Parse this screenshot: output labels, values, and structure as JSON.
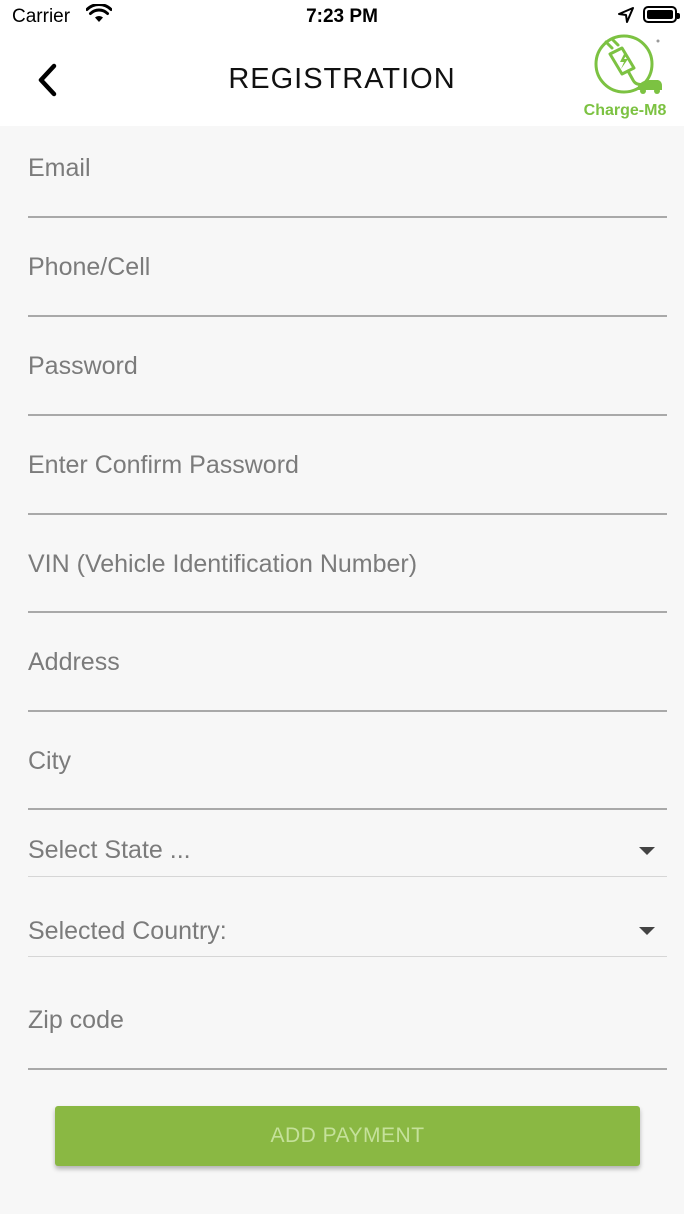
{
  "status_bar": {
    "carrier": "Carrier",
    "time": "7:23 PM"
  },
  "header": {
    "title": "REGISTRATION",
    "logo_text": "Charge-M8"
  },
  "form": {
    "fields": [
      {
        "placeholder": "Email"
      },
      {
        "placeholder": "Phone/Cell"
      },
      {
        "placeholder": "Password"
      },
      {
        "placeholder": "Enter Confirm Password"
      },
      {
        "placeholder": "VIN (Vehicle Identification Number)"
      },
      {
        "placeholder": "Address"
      },
      {
        "placeholder": "City"
      }
    ],
    "state_select": {
      "placeholder": "Select State ..."
    },
    "country_select": {
      "placeholder": "Selected Country:"
    },
    "zip": {
      "placeholder": "Zip code"
    }
  },
  "add_payment_button": {
    "label": "ADD PAYMENT"
  },
  "colors": {
    "accent": "#8ab843",
    "brand": "#7cc242"
  }
}
